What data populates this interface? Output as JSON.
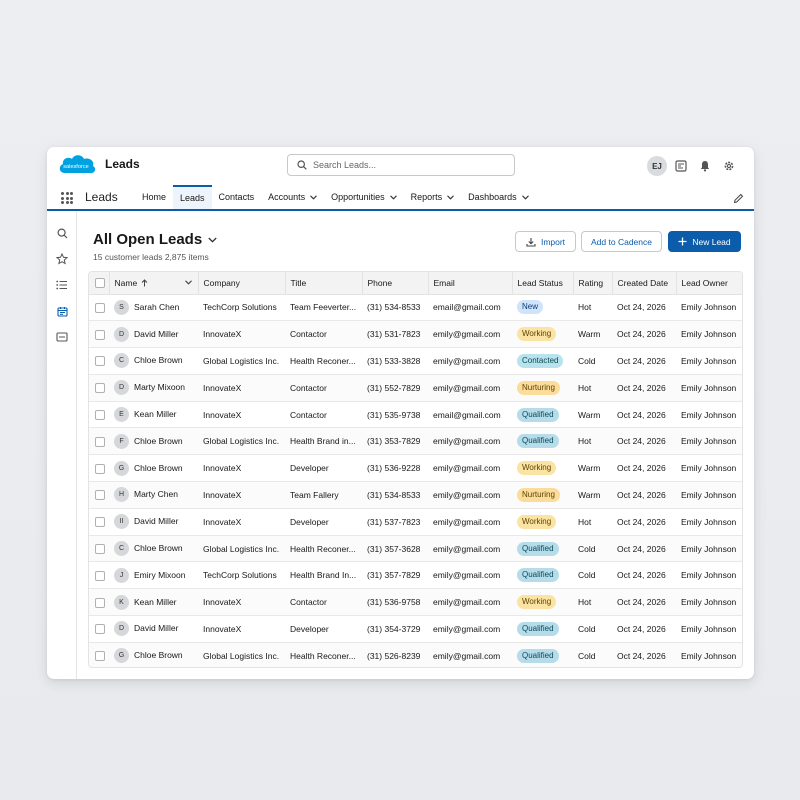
{
  "header": {
    "logo_text": "salesforce",
    "app_title": "Leads",
    "search_placeholder": "Search Leads...",
    "avatar_initials": "EJ",
    "icons": [
      "grid-icon",
      "bell-icon",
      "gear-icon"
    ]
  },
  "nav": {
    "app_name": "Leads",
    "tabs": [
      {
        "label": "Home",
        "dropdown": false
      },
      {
        "label": "Leads",
        "dropdown": false,
        "active": true
      },
      {
        "label": "Contacts",
        "dropdown": false
      },
      {
        "label": "Accounts",
        "dropdown": true
      },
      {
        "label": "Opportunities",
        "dropdown": true
      },
      {
        "label": "Reports",
        "dropdown": true
      },
      {
        "label": "Dashboards",
        "dropdown": true
      }
    ]
  },
  "list": {
    "title": "All Open Leads",
    "subtitle": "15 customer leads 2,875 items",
    "import_label": "Import",
    "cadence_label": "Add to Cadence",
    "new_label": "New Lead"
  },
  "table": {
    "columns": [
      "Name",
      "Company",
      "Title",
      "Phone",
      "Email",
      "Lead Status",
      "Rating",
      "Created Date",
      "Lead Owner"
    ],
    "rows": [
      {
        "initial": "S",
        "name": "Sarah Chen",
        "company": "TechCorp Solutions",
        "title": "Team Feeverter...",
        "phone": "(31) 534-8533",
        "email": "email@gmail.com",
        "status": "New",
        "status_class": "new",
        "rating": "Hot",
        "date": "Oct 24, 2026",
        "owner": "Emily Johnson"
      },
      {
        "initial": "D",
        "name": "David Miller",
        "company": "InnovateX",
        "title": "Contactor",
        "phone": "(31) 531-7823",
        "email": "emily@gmail.com",
        "status": "Working",
        "status_class": "working",
        "rating": "Warm",
        "date": "Oct 24, 2026",
        "owner": "Emily Johnson"
      },
      {
        "initial": "C",
        "name": "Chloe Brown",
        "company": "Global Logistics Inc.",
        "title": "Health Reconer...",
        "phone": "(31) 533-3828",
        "email": "emily@gmail.com",
        "status": "Contacted",
        "status_class": "contacted",
        "rating": "Cold",
        "date": "Oct 24, 2026",
        "owner": "Emily Johnson"
      },
      {
        "initial": "D",
        "name": "Marty Mixoon",
        "company": "InnovateX",
        "title": "Contactor",
        "phone": "(31) 552-7829",
        "email": "emily@gmail.com",
        "status": "Nurturing",
        "status_class": "nurturing",
        "rating": "Hot",
        "date": "Oct 24, 2026",
        "owner": "Emily Johnson"
      },
      {
        "initial": "E",
        "name": "Kean Miller",
        "company": "InnovateX",
        "title": "Contactor",
        "phone": "(31) 535-9738",
        "email": "email@gmail.com",
        "status": "Qualified",
        "status_class": "qualified",
        "rating": "Warm",
        "date": "Oct 24, 2026",
        "owner": "Emily Johnson"
      },
      {
        "initial": "F",
        "name": "Chloe Brown",
        "company": "Global Logistics Inc.",
        "title": "Health Brand in...",
        "phone": "(31) 353-7829",
        "email": "emily@gmail.com",
        "status": "Qualified",
        "status_class": "qualified",
        "rating": "Hot",
        "date": "Oct 24, 2026",
        "owner": "Emily Johnson"
      },
      {
        "initial": "G",
        "name": "Chloe Brown",
        "company": "InnovateX",
        "title": "Developer",
        "phone": "(31) 536-9228",
        "email": "emily@gmail.com",
        "status": "Working",
        "status_class": "working",
        "rating": "Warm",
        "date": "Oct 24, 2026",
        "owner": "Emily Johnson"
      },
      {
        "initial": "H",
        "name": "Marty Chen",
        "company": "InnovateX",
        "title": "Team Fallery",
        "phone": "(31) 534-8533",
        "email": "emily@gmail.com",
        "status": "Nurturing",
        "status_class": "nurturing",
        "rating": "Warm",
        "date": "Oct 24, 2026",
        "owner": "Emily Johnson"
      },
      {
        "initial": "II",
        "name": "David Miller",
        "company": "InnovateX",
        "title": "Developer",
        "phone": "(31) 537-7823",
        "email": "emily@gmail.com",
        "status": "Working",
        "status_class": "working",
        "rating": "Hot",
        "date": "Oct 24, 2026",
        "owner": "Emily Johnson"
      },
      {
        "initial": "C",
        "name": "Chloe Brown",
        "company": "Global Logistics Inc.",
        "title": "Health Reconer...",
        "phone": "(31) 357-3628",
        "email": "emily@gmail.com",
        "status": "Qualified",
        "status_class": "qualified",
        "rating": "Cold",
        "date": "Oct 24, 2026",
        "owner": "Emily Johnson"
      },
      {
        "initial": "J",
        "name": "Emiry Mixoon",
        "company": "TechCorp Solutions",
        "title": "Health Brand In...",
        "phone": "(31) 357-7829",
        "email": "emily@gmail.com",
        "status": "Qualified",
        "status_class": "qualified",
        "rating": "Cold",
        "date": "Oct 24, 2026",
        "owner": "Emily Johnson"
      },
      {
        "initial": "K",
        "name": "Kean Miller",
        "company": "InnovateX",
        "title": "Contactor",
        "phone": "(31) 536-9758",
        "email": "emily@gmail.com",
        "status": "Working",
        "status_class": "working",
        "rating": "Hot",
        "date": "Oct 24, 2026",
        "owner": "Emily Johnson"
      },
      {
        "initial": "D",
        "name": "David Miller",
        "company": "InnovateX",
        "title": "Developer",
        "phone": "(31) 354-3729",
        "email": "emily@gmail.com",
        "status": "Qualified",
        "status_class": "qualified",
        "rating": "Cold",
        "date": "Oct 24, 2026",
        "owner": "Emily Johnson"
      },
      {
        "initial": "G",
        "name": "Chloe Brown",
        "company": "Global Logistics Inc.",
        "title": "Health Reconer...",
        "phone": "(31) 526-8239",
        "email": "emily@gmail.com",
        "status": "Qualified",
        "status_class": "qualified",
        "rating": "Cold",
        "date": "Oct 24, 2026",
        "owner": "Emily Johnson"
      }
    ]
  },
  "colors": {
    "brand": "#0b5cab",
    "logo": "#00a1e0"
  }
}
